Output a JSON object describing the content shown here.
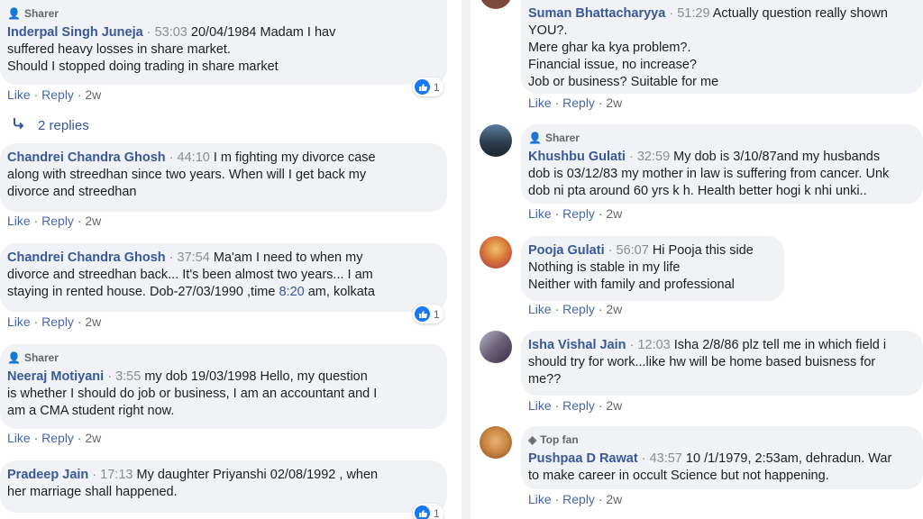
{
  "common": {
    "like": "Like",
    "reply": "Reply",
    "age": "2w",
    "sharer": "Sharer",
    "top_fan": "Top fan",
    "dot": "·"
  },
  "left": {
    "comments": [
      {
        "badge": "Sharer",
        "author": "Inderpal Singh Juneja",
        "time": "53:03",
        "lines": [
          "20/04/1984 Madam I hav",
          "suffered heavy losses in share market.",
          "Should I stopped doing trading in share market"
        ],
        "reactions": "1"
      },
      {
        "author": "Chandrei Chandra Ghosh",
        "time": "44:10",
        "lines": [
          "I m fighting my divorce case",
          "along with streedhan since two years. When will I get back my",
          "divorce and streedhan"
        ]
      },
      {
        "author": "Chandrei Chandra Ghosh",
        "time": "37:54",
        "lines": [
          "Ma'am I need to when my",
          "divorce and streedhan back... It's been almost two years... I am",
          "staying in rented house. Dob-27/03/1990 ,time "
        ],
        "time_link": "8:20",
        "line3_tail": " am, kolkata",
        "reactions": "1"
      },
      {
        "badge": "Sharer",
        "author": "Neeraj Motiyani",
        "time": "3:55",
        "lines": [
          "my dob 19/03/1998 Hello, my question",
          "is whether I should do job or business, I am an accountant and I",
          "am a CMA student right now."
        ]
      },
      {
        "author": "Pradeep Jain",
        "time": "17:13",
        "lines": [
          "My daughter Priyanshi 02/08/1992 , when",
          "her marriage shall happened."
        ],
        "reactions": "1"
      }
    ],
    "replies_label": "2 replies"
  },
  "right": {
    "comments": [
      {
        "author": "Suman Bhattacharyya",
        "time": "51:29",
        "lines": [
          "Actually question really shown",
          "YOU?.",
          "Mere ghar ka kya problem?.",
          "Financial issue, no increase?",
          "Job or business? Suitable for me"
        ]
      },
      {
        "badge": "Sharer",
        "author": "Khushbu Gulati",
        "time": "32:59",
        "lines": [
          "My dob is 3/10/87and my husbands",
          "dob is 03/12/83 my mother in law is suffering from cancer. Unk",
          "dob ni pta around 60 yrs k h. Health better hogi k nhi unki.."
        ]
      },
      {
        "author": "Pooja Gulati",
        "time": "56:07",
        "lines": [
          "Hi Pooja this side",
          "Nothing is stable in my life",
          "Neither with family and professional"
        ]
      },
      {
        "author": "Isha Vishal Jain",
        "time": "12:03",
        "lines": [
          "Isha 2/8/86 plz tell me in which field i",
          "should try for work...like hw will be home based buisness for",
          "me??"
        ]
      },
      {
        "badge": "Top fan",
        "author": "Pushpaa D Rawat",
        "time": "43:57",
        "lines": [
          "10 /1/1979, 2:53am, dehradun. War",
          "to make career in occult Science but not happening."
        ]
      }
    ]
  },
  "colors": {
    "link": "#385898",
    "bubble": "#f0f2f5",
    "like_blue": "#1877f2",
    "meta": "#65676b"
  }
}
